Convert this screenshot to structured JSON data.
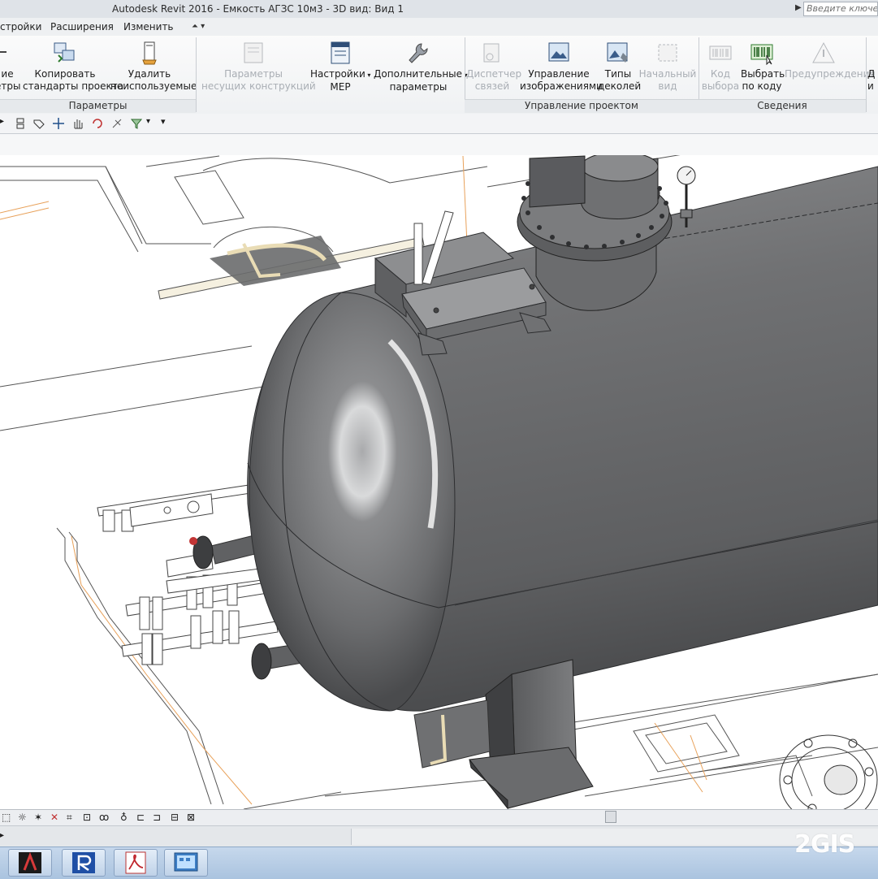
{
  "titlebar": {
    "title": "Autodesk Revit 2016 -     Емкость АГЗС 10м3 - 3D вид: Вид 1",
    "search_placeholder": "Введите ключевое слово"
  },
  "menu": {
    "items": [
      "стройки",
      "Расширения",
      "Изменить"
    ]
  },
  "ribbon": {
    "buttons": [
      {
        "label1": "ие",
        "label2": "етры",
        "disabled": false
      },
      {
        "label1": "Копировать",
        "label2": "стандарты проекта",
        "disabled": false
      },
      {
        "label1": "Удалить",
        "label2": "неиспользуемые",
        "disabled": false
      },
      {
        "label1": "Параметры",
        "label2": "несущих конструкций",
        "disabled": true
      },
      {
        "label1": "Настройки",
        "label2": "MEP",
        "disabled": false,
        "dropdown": true
      },
      {
        "label1": "Дополнительные",
        "label2": "параметры",
        "disabled": false,
        "dropdown": true
      },
      {
        "label1": "Диспетчер",
        "label2": "связей",
        "disabled": true
      },
      {
        "label1": "Управление",
        "label2": "изображениями",
        "disabled": false
      },
      {
        "label1": "Типы",
        "label2": "деколей",
        "disabled": false
      },
      {
        "label1": "Начальный",
        "label2": "вид",
        "disabled": true
      },
      {
        "label1": "Код",
        "label2": "выбора",
        "disabled": true
      },
      {
        "label1": "Выбрать",
        "label2": "по коду",
        "disabled": false
      },
      {
        "label1": "Предупреждения",
        "label2": "",
        "disabled": true
      },
      {
        "label1": "Д",
        "label2": "и",
        "disabled": false
      }
    ],
    "groups": [
      "Параметры",
      "Управление проектом",
      "Сведения"
    ]
  },
  "colors": {
    "tank": "#6e6f71",
    "ribbon_bg": "#f4f5f6",
    "taskbar": "#b5cbe4",
    "orange_line": "#e8a15a"
  },
  "watermark": "2GIS",
  "taskbar": {
    "apps": [
      "autocad-icon",
      "revit-icon",
      "pdf-reader-icon",
      "control-panel-icon"
    ]
  }
}
